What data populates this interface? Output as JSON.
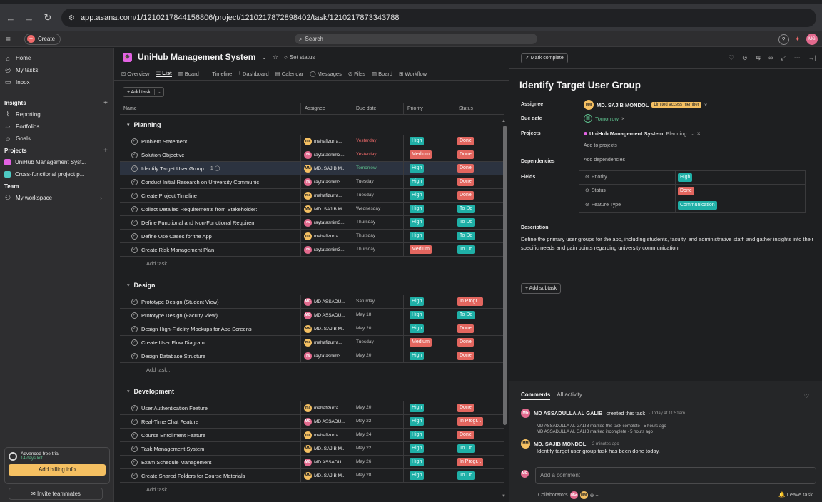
{
  "browser": {
    "url": "app.asana.com/1/1210217844156806/project/1210217872898402/task/1210217873343788"
  },
  "topbar": {
    "create_label": "Create",
    "search_label": "Search",
    "user_initials": "MG"
  },
  "sidebar": {
    "home": "Home",
    "my_tasks": "My tasks",
    "inbox": "Inbox",
    "insights_header": "Insights",
    "reporting": "Reporting",
    "portfolios": "Portfolios",
    "goals": "Goals",
    "projects_header": "Projects",
    "projects": [
      {
        "label": "UniHub Management Syst...",
        "color": "#e362e3"
      },
      {
        "label": "Cross-functional project p...",
        "color": "#4ecbc4"
      }
    ],
    "team_header": "Team",
    "my_workspace": "My workspace",
    "trial_title": "Advanced free trial",
    "trial_days": "14 days left",
    "billing_label": "Add billing info",
    "invite_label": "Invite teammates"
  },
  "project": {
    "icon_text": "🎓",
    "name": "UniHub Management System",
    "set_status": "Set status",
    "tabs": [
      "Overview",
      "List",
      "Board",
      "Timeline",
      "Dashboard",
      "Calendar",
      "Messages",
      "Files",
      "Board",
      "Workflow"
    ],
    "add_task_label": "+ Add task"
  },
  "columns": [
    "Name",
    "Assignee",
    "Due date",
    "Priority",
    "Status"
  ],
  "sections": [
    {
      "title": "Planning",
      "tasks": [
        {
          "name": "Problem Statement",
          "av": "ma",
          "assignee": "mahafizurra...",
          "due": "Yesterday",
          "due_style": "red",
          "priority": "High",
          "status": "Done"
        },
        {
          "name": "Solution Objective",
          "av": "ra",
          "assignee": "raytatasnim3...",
          "due": "Yesterday",
          "due_style": "red",
          "priority": "Medium",
          "status": "Done"
        },
        {
          "name": "Identify Target User Group",
          "sub": "1 ◯",
          "av": "MM",
          "assignee": "MD. SAJIB M...",
          "due": "Tomorrow",
          "due_style": "green",
          "priority": "High",
          "status": "Done",
          "selected": true
        },
        {
          "name": "Conduct Initial Research on University Communic",
          "av": "ra",
          "assignee": "raytatasnim3...",
          "due": "Tuesday",
          "due_style": "",
          "priority": "High",
          "status": "Done"
        },
        {
          "name": "Create Project Timeline",
          "av": "ma",
          "assignee": "mahafizurra...",
          "due": "Tuesday",
          "due_style": "",
          "priority": "High",
          "status": "Done"
        },
        {
          "name": "Collect Detailed Requirements from Stakeholder:",
          "av": "MM",
          "assignee": "MD. SAJIB M...",
          "due": "Wednesday",
          "due_style": "",
          "priority": "High",
          "status": "To Do"
        },
        {
          "name": "Define Functional and Non-Functional Requirem",
          "av": "ra",
          "assignee": "raytatasnim3...",
          "due": "Thursday",
          "due_style": "",
          "priority": "High",
          "status": "To Do"
        },
        {
          "name": "Define Use Cases for the App",
          "av": "ma",
          "assignee": "mahafizurra...",
          "due": "Thursday",
          "due_style": "",
          "priority": "High",
          "status": "To Do"
        },
        {
          "name": "Create Risk Management Plan",
          "av": "ra",
          "assignee": "raytatasnim3...",
          "due": "Thursday",
          "due_style": "",
          "priority": "Medium",
          "status": "To Do"
        }
      ]
    },
    {
      "title": "Design",
      "tasks": [
        {
          "name": "Prototype Design (Student View)",
          "av": "MG",
          "assignee": "MD ASSADU...",
          "due": "Saturday",
          "due_style": "",
          "priority": "High",
          "status": "In Progr..."
        },
        {
          "name": "Prototype Design (Faculty View)",
          "av": "MG",
          "assignee": "MD ASSADU...",
          "due": "May 18",
          "due_style": "",
          "priority": "High",
          "status": "To Do"
        },
        {
          "name": "Design High-Fidelity Mockups for App Screens",
          "av": "MM",
          "assignee": "MD. SAJIB M...",
          "due": "May 20",
          "due_style": "",
          "priority": "High",
          "status": "Done"
        },
        {
          "name": "Create User Flow Diagram",
          "av": "ma",
          "assignee": "mahafizurra...",
          "due": "Tuesday",
          "due_style": "",
          "priority": "Medium",
          "status": "Done"
        },
        {
          "name": "Design Database Structure",
          "av": "ra",
          "assignee": "raytatasnim3...",
          "due": "May 20",
          "due_style": "",
          "priority": "High",
          "status": "Done"
        }
      ]
    },
    {
      "title": "Development",
      "tasks": [
        {
          "name": "User Authentication Feature",
          "av": "ma",
          "assignee": "mahafizurra...",
          "due": "May 20",
          "due_style": "",
          "priority": "High",
          "status": "Done"
        },
        {
          "name": "Real-Time Chat Feature",
          "av": "MG",
          "assignee": "MD ASSADU...",
          "due": "May 22",
          "due_style": "",
          "priority": "High",
          "status": "In Progr..."
        },
        {
          "name": "Course Enrollment Feature",
          "av": "ma",
          "assignee": "mahafizurra...",
          "due": "May 24",
          "due_style": "",
          "priority": "High",
          "status": "Done"
        },
        {
          "name": "Task Management System",
          "av": "MM",
          "assignee": "MD. SAJIB M...",
          "due": "May 22",
          "due_style": "",
          "priority": "High",
          "status": "To Do"
        },
        {
          "name": "Exam Schedule Management",
          "av": "MG",
          "assignee": "MD ASSADU...",
          "due": "May 26",
          "due_style": "",
          "priority": "High",
          "status": "In Progr..."
        },
        {
          "name": "Create Shared Folders for Course Materials",
          "av": "MM",
          "assignee": "MD. SAJIB M...",
          "due": "May 28",
          "due_style": "",
          "priority": "High",
          "status": "To Do"
        }
      ]
    }
  ],
  "add_task_row": "Add task...",
  "detail": {
    "mark_complete": "✓ Mark complete",
    "title": "Identify Target User Group",
    "assignee_label": "Assignee",
    "assignee_initials": "MM",
    "assignee_name": "MD. SAJIB MONDOL",
    "limited_badge": "Limited access member",
    "due_label": "Due date",
    "due_value": "Tomorrow",
    "projects_label": "Projects",
    "project_name": "UniHub Management System",
    "project_section": "Planning",
    "add_to_projects": "Add to projects",
    "dependencies_label": "Dependencies",
    "add_dependencies": "Add dependencies",
    "fields_label": "Fields",
    "fields": [
      {
        "name": "Priority",
        "value": "High",
        "style": "high"
      },
      {
        "name": "Status",
        "value": "Done",
        "style": "done"
      },
      {
        "name": "Feature Type",
        "value": "Communication",
        "style": "comm"
      }
    ],
    "description_label": "Description",
    "description": "Define the primary user groups for the app, including students, faculty, and administrative staff, and gather insights into their specific needs and pain points regarding university communication.",
    "add_subtask": "+ Add subtask"
  },
  "comments": {
    "tab_comments": "Comments",
    "tab_activity": "All activity",
    "created_by": "MD ASSADULLA AL GALIB",
    "created_text": "created this task",
    "created_time": "· Today at 11:51am",
    "log1": "MD ASSADULLA AL GALIB marked this task complete · 5 hours ago",
    "log2": "MD ASSADULLA AL GALIB marked incomplete · 5 hours ago",
    "comment_author": "MD. SAJIB MONDOL",
    "comment_time": "· 2 minutes ago",
    "comment_text": "Identify target user group task has been done today.",
    "placeholder": "Add a comment",
    "collaborators": "Collaborators",
    "leave_task": "Leave task"
  }
}
